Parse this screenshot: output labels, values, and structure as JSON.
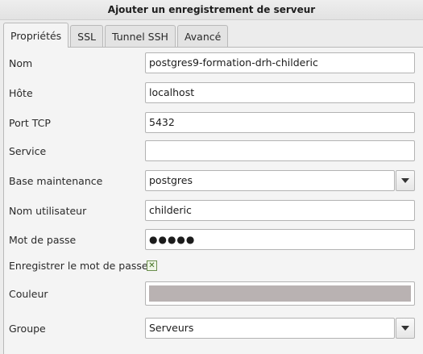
{
  "window": {
    "title": "Ajouter un enregistrement de serveur"
  },
  "tabs": [
    {
      "label": "Propriétés",
      "active": true
    },
    {
      "label": "SSL",
      "active": false
    },
    {
      "label": "Tunnel SSH",
      "active": false
    },
    {
      "label": "Avancé",
      "active": false
    }
  ],
  "form": {
    "name": {
      "label": "Nom",
      "value": "postgres9-formation-drh-childeric"
    },
    "host": {
      "label": "Hôte",
      "value": "localhost"
    },
    "port": {
      "label": "Port TCP",
      "value": "5432"
    },
    "service": {
      "label": "Service",
      "value": ""
    },
    "maintenance_db": {
      "label": "Base maintenance",
      "value": "postgres"
    },
    "username": {
      "label": "Nom utilisateur",
      "value": "childeric"
    },
    "password": {
      "label": "Mot de passe",
      "value": "●●●●●"
    },
    "save_password": {
      "label": "Enregistrer le mot de passe",
      "checked": true,
      "mark": "✕"
    },
    "color": {
      "label": "Couleur",
      "swatch": "#b9b2b2"
    },
    "group": {
      "label": "Groupe",
      "value": "Serveurs"
    }
  },
  "colors": {
    "accent_check": "#3f6e1f"
  },
  "icons": {
    "combo": "chevron-down-icon",
    "checkbox": "check-icon"
  }
}
